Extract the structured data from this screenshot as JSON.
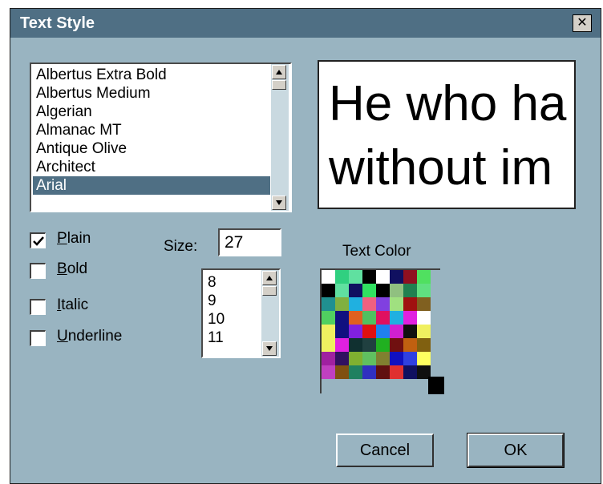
{
  "dialog": {
    "title": "Text Style",
    "close_glyph": "✕"
  },
  "font_list": {
    "items": [
      "Albertus Extra Bold",
      "Albertus Medium",
      "Algerian",
      "Almanac MT",
      "Antique Olive",
      "Architect",
      "Arial"
    ],
    "selected": "Arial"
  },
  "preview": {
    "line1": "He who ha",
    "line2": "without im"
  },
  "styles": {
    "plain_label": "Plain",
    "plain_checked": true,
    "bold_label": "Bold",
    "bold_checked": false,
    "italic_label": "Italic",
    "italic_checked": false,
    "underline_label": "Underline",
    "underline_checked": false
  },
  "size": {
    "label": "Size:",
    "value": "27",
    "options": [
      "8",
      "9",
      "10",
      "11"
    ]
  },
  "color": {
    "label": "Text Color",
    "palette": [
      [
        "#ffffff",
        "#30d080",
        "#60e0a0",
        "#000000",
        "#ffffff",
        "#101060",
        "#901020",
        "#50e060"
      ],
      [
        "#000000",
        "#60e0a0",
        "#101060",
        "#30e060",
        "#000000",
        "#90c080",
        "#208050",
        "#60e080"
      ],
      [
        "#209090",
        "#80b040",
        "#20b0e0",
        "#f06080",
        "#8040e0",
        "#a0e080",
        "#a01010",
        "#806020"
      ],
      [
        "#50d060",
        "#101080",
        "#e06020",
        "#50c060",
        "#e01060",
        "#20b0e0",
        "#e020e0",
        "#ffffff"
      ],
      [
        "#f0f060",
        "#101080",
        "#8020e0",
        "#e01010",
        "#2080f0",
        "#d020d0",
        "#101010",
        "#f0f060"
      ],
      [
        "#f0f060",
        "#e020e0",
        "#103030",
        "#204040",
        "#20b020",
        "#701010",
        "#c06010",
        "#806010"
      ],
      [
        "#a020a0",
        "#301060",
        "#80b030",
        "#60c060",
        "#808030",
        "#1010c0",
        "#3040e0",
        "#ffff60"
      ],
      [
        "#c040c0",
        "#805010",
        "#208060",
        "#3030c0",
        "#601010",
        "#e03030",
        "#101060",
        "#101010"
      ]
    ],
    "selected": "#000000"
  },
  "buttons": {
    "cancel": "Cancel",
    "ok": "OK"
  }
}
